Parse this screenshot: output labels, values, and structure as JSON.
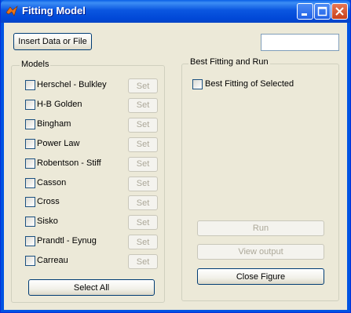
{
  "window": {
    "title": "Fitting Model"
  },
  "toolbar": {
    "insert_label": "Insert Data or File",
    "input_value": ""
  },
  "models": {
    "title": "Models",
    "set_label": "Set",
    "items": [
      {
        "label": "Herschel - Bulkley",
        "checked": false
      },
      {
        "label": "H-B Golden",
        "checked": false
      },
      {
        "label": "Bingham",
        "checked": false
      },
      {
        "label": "Power Law",
        "checked": false
      },
      {
        "label": "Robentson - Stiff",
        "checked": false
      },
      {
        "label": "Casson",
        "checked": false
      },
      {
        "label": "Cross",
        "checked": false
      },
      {
        "label": "Sisko",
        "checked": false
      },
      {
        "label": "Prandtl - Eynug",
        "checked": false
      },
      {
        "label": "Carreau",
        "checked": false
      }
    ],
    "select_all_label": "Select All"
  },
  "best": {
    "title": "Best Fitting and Run",
    "checkbox_label": "Best Fitting of Selected",
    "run_label": "Run",
    "view_label": "View output",
    "close_label": "Close Figure"
  }
}
